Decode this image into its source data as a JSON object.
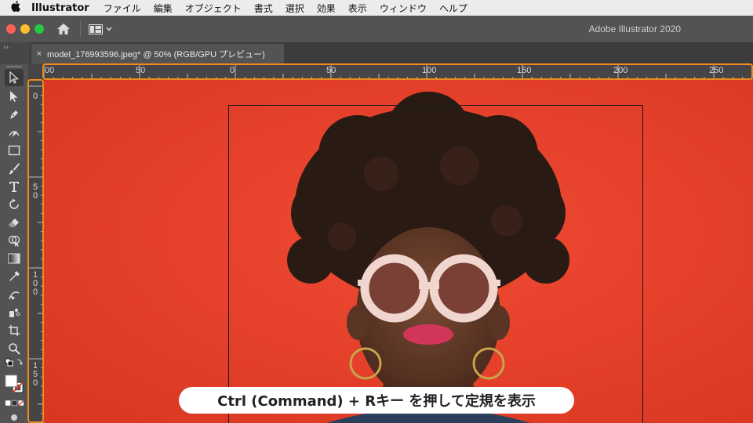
{
  "menubar": {
    "app_name": "Illustrator",
    "items": [
      "ファイル",
      "編集",
      "オブジェクト",
      "書式",
      "選択",
      "効果",
      "表示",
      "ウィンドウ",
      "ヘルプ"
    ]
  },
  "titlebar": {
    "app_title": "Adobe Illustrator 2020"
  },
  "tab_strip_left": "››",
  "document_tab": {
    "close_glyph": "×",
    "title": "model_176993596.jpeg* @ 50% (RGB/GPU プレビュー)"
  },
  "ruler_h": {
    "labels": [
      "00",
      "50",
      "0",
      "50",
      "100",
      "150",
      "200",
      "250"
    ]
  },
  "ruler_v": {
    "labels": [
      "0",
      "50",
      "100",
      "150"
    ]
  },
  "caption": "Ctrl (Command) + Rキー を押して定規を表示",
  "colors": {
    "highlight": "#f08a1c",
    "canvas_bg": "#e8412c",
    "panel": "#535353"
  }
}
